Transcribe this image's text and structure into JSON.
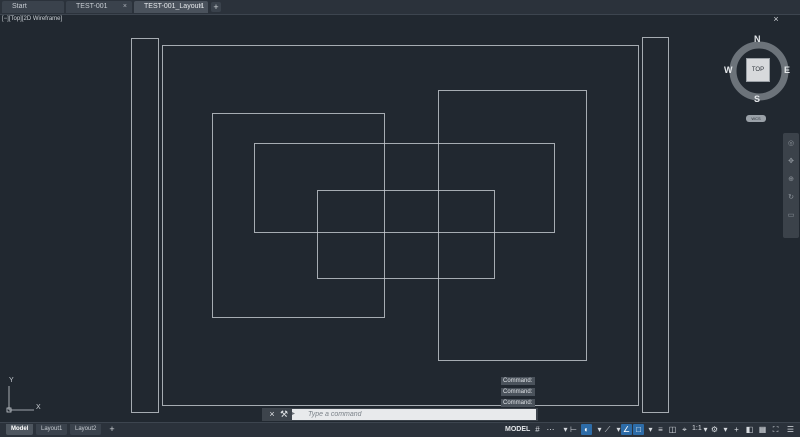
{
  "file_tabs": [
    {
      "label": "Start",
      "active": false
    },
    {
      "label": "TEST-001",
      "active": false
    },
    {
      "label": "TEST-001_Layout1",
      "active": true
    }
  ],
  "viewport": {
    "label": "[−][Top][2D Wireframe]"
  },
  "viewcube": {
    "face": "TOP",
    "north": "N",
    "south": "S",
    "east": "E",
    "west": "W",
    "wcs": "WCS"
  },
  "ucs": {
    "x": "X",
    "y": "Y"
  },
  "command_history": [
    "Command:",
    "Command:",
    "Command:"
  ],
  "command_line": {
    "placeholder": "Type a command"
  },
  "layout_tabs": [
    {
      "label": "Model",
      "active": true
    },
    {
      "label": "Layout1",
      "active": false
    },
    {
      "label": "Layout2",
      "active": false
    }
  ],
  "status_bar": {
    "model": "MODEL",
    "scale": "1:1"
  }
}
